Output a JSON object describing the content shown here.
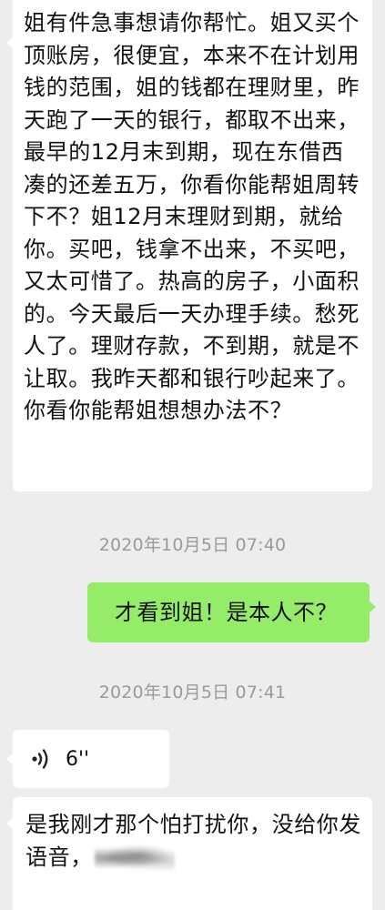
{
  "messages": [
    {
      "side": "left",
      "text": "姐有件急事想请你帮忙。姐又买个顶账房，很便宜，本来不在计划用钱的范围，姐的钱都在理财里，昨天跑了一天的银行，都取不出来，最早的12月末到期，现在东借西凑的还差五万，你看你能帮姐周转下不？姐12月末理财到期，就给你。买吧，钱拿不出来，不买吧，又太可惜了。热高的房子，小面积的。今天最后一天办理手续。愁死人了。理财存款，不到期，就是不让取。我昨天都和银行吵起来了。你看你能帮姐想想办法不？"
    },
    {
      "side": "right",
      "text": "才看到姐！是本人不？"
    },
    {
      "side": "left",
      "type": "voice",
      "duration": "6''"
    },
    {
      "side": "left",
      "text": "是我刚才那个怕打扰你，没给你发语音，"
    }
  ],
  "timestamps": [
    "2020年10月5日 07:40",
    "2020年10月5日 07:41"
  ],
  "colors": {
    "background": "#ededed",
    "incoming_bubble": "#ffffff",
    "outgoing_bubble": "#95ec69",
    "timestamp_text": "#9a9a9a"
  },
  "icons": {
    "voice": "voice-wave-icon"
  }
}
